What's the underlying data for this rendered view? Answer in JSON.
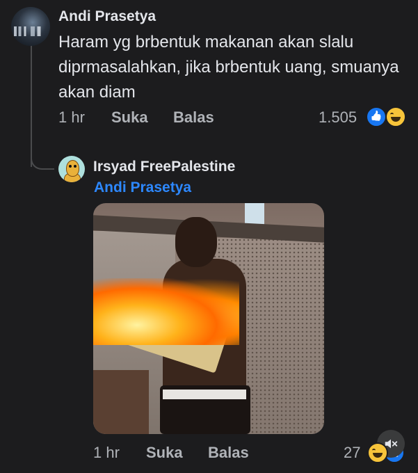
{
  "comment": {
    "author": "Andi Prasetya",
    "text": "Haram yg brbentuk makanan akan slalu diprmasalahkan, jika brbentuk uang, smuanya akan diam",
    "time": "1 hr",
    "like_label": "Suka",
    "reply_label": "Balas",
    "reaction_count": "1.505",
    "reactions": [
      "like-icon",
      "haha-icon"
    ]
  },
  "reply": {
    "author": "Irsyad FreePalestine",
    "mention": "Andi Prasetya",
    "image_icon": "photo-of-boy-burning-book",
    "time": "1 hr",
    "like_label": "Suka",
    "reply_label": "Balas",
    "reaction_count": "27",
    "reactions": [
      "haha-icon",
      "like-icon"
    ]
  },
  "controls": {
    "sound_icon": "muted-speaker-icon"
  },
  "colors": {
    "background": "#1c1c1e",
    "text": "#e4e6eb",
    "muted": "#b0b3b8",
    "mention": "#2d88ff"
  }
}
